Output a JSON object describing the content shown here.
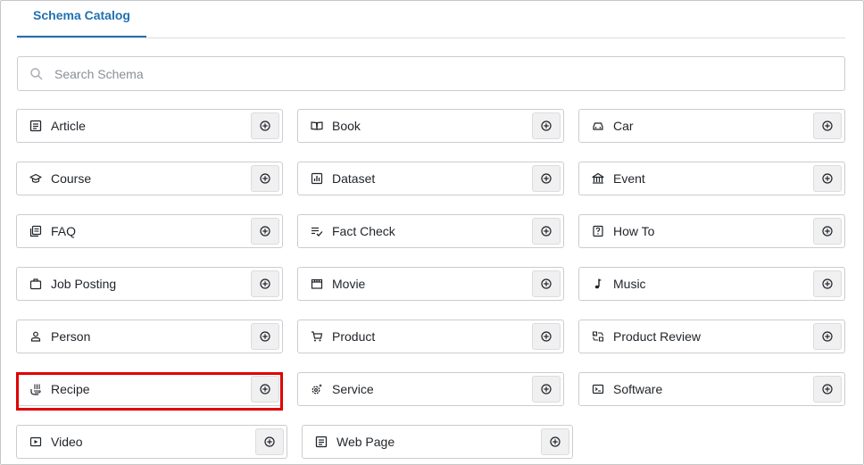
{
  "tabs": [
    {
      "label": "Schema Catalog",
      "active": true
    }
  ],
  "search": {
    "placeholder": "Search Schema",
    "value": ""
  },
  "schemas": [
    {
      "label": "Article",
      "icon": "article-icon"
    },
    {
      "label": "Book",
      "icon": "book-icon"
    },
    {
      "label": "Car",
      "icon": "car-icon"
    },
    {
      "label": "Course",
      "icon": "course-icon"
    },
    {
      "label": "Dataset",
      "icon": "dataset-icon"
    },
    {
      "label": "Event",
      "icon": "event-icon"
    },
    {
      "label": "FAQ",
      "icon": "faq-icon"
    },
    {
      "label": "Fact Check",
      "icon": "fact-check-icon"
    },
    {
      "label": "How To",
      "icon": "how-to-icon"
    },
    {
      "label": "Job Posting",
      "icon": "job-posting-icon"
    },
    {
      "label": "Movie",
      "icon": "movie-icon"
    },
    {
      "label": "Music",
      "icon": "music-icon"
    },
    {
      "label": "Person",
      "icon": "person-icon"
    },
    {
      "label": "Product",
      "icon": "product-icon"
    },
    {
      "label": "Product Review",
      "icon": "product-review-icon"
    },
    {
      "label": "Recipe",
      "icon": "recipe-icon",
      "highlighted": true
    },
    {
      "label": "Service",
      "icon": "service-icon"
    },
    {
      "label": "Software",
      "icon": "software-icon"
    },
    {
      "label": "Video",
      "icon": "video-icon"
    },
    {
      "label": "Web Page",
      "icon": "web-page-icon"
    }
  ],
  "colors": {
    "accent": "#2271b1",
    "highlight": "#e00000",
    "border": "#c9ccd1"
  }
}
